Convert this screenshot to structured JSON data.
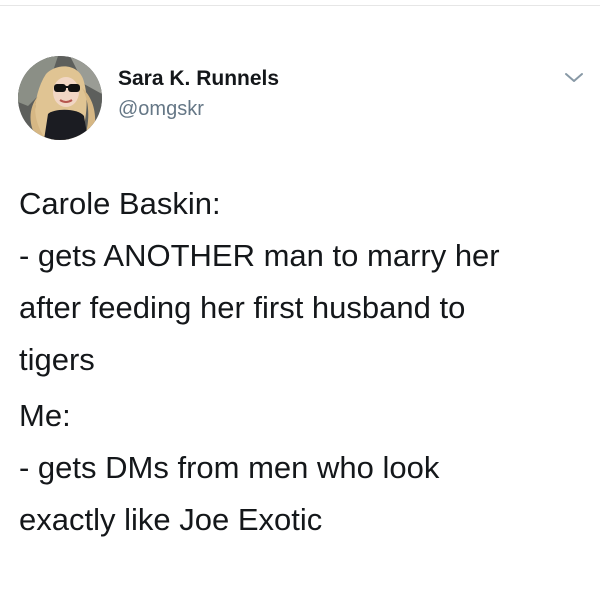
{
  "tweet": {
    "author": {
      "display_name": "Sara K. Runnels",
      "handle": "@omgskr",
      "avatar_icon": "profile-photo",
      "menu_icon": "chevron-down-icon"
    },
    "paragraphs": [
      {
        "lines": [
          "Carole Baskin:",
          "- gets ANOTHER man to marry her",
          "after feeding her first husband to",
          "tigers"
        ]
      },
      {
        "lines": [
          "Me:",
          "- gets DMs from men who look",
          "exactly like Joe Exotic"
        ]
      }
    ]
  },
  "colors": {
    "text": "#14171a",
    "secondary_text": "#657786",
    "background": "#ffffff"
  }
}
